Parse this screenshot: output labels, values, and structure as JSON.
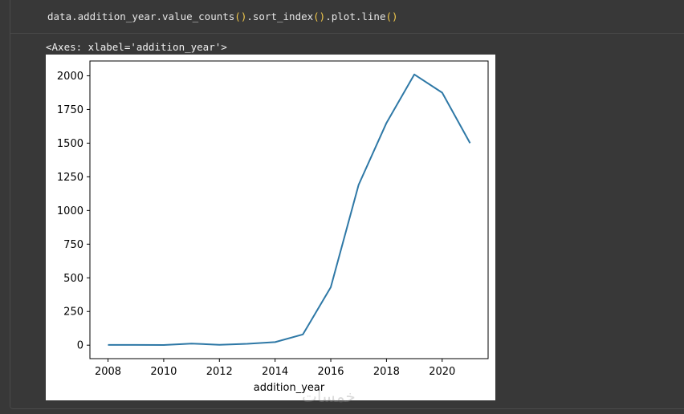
{
  "cell": {
    "code_parts": [
      "data.addition_year.value_counts",
      "()",
      ".sort_index",
      "()",
      ".plot.line",
      "()"
    ],
    "output_text": "<Axes: xlabel='addition_year'>"
  },
  "watermark": "خمسات",
  "colors": {
    "line": "#2e78a6",
    "background": "#383838",
    "paren": "#f2c94c"
  },
  "chart_data": {
    "type": "line",
    "x": [
      2008,
      2009,
      2010,
      2011,
      2012,
      2013,
      2014,
      2015,
      2016,
      2017,
      2018,
      2019,
      2020,
      2021
    ],
    "series": [
      {
        "values": [
          2,
          2,
          1,
          12,
          3,
          10,
          23,
          80,
          430,
          1190,
          1650,
          2010,
          1875,
          1500
        ]
      }
    ],
    "xlabel": "addition_year",
    "ylabel": "",
    "title": "",
    "xlim": [
      2007.35,
      2021.65
    ],
    "ylim": [
      -100,
      2110
    ],
    "x_ticks": [
      2008,
      2010,
      2012,
      2014,
      2016,
      2018,
      2020
    ],
    "y_ticks": [
      0,
      250,
      500,
      750,
      1000,
      1250,
      1500,
      1750,
      2000
    ],
    "x_tick_labels": [
      "2008",
      "2010",
      "2012",
      "2014",
      "2016",
      "2018",
      "2020"
    ],
    "y_tick_labels": [
      "0",
      "250",
      "500",
      "750",
      "1000",
      "1250",
      "1500",
      "1750",
      "2000"
    ],
    "grid": false,
    "legend": "none"
  }
}
